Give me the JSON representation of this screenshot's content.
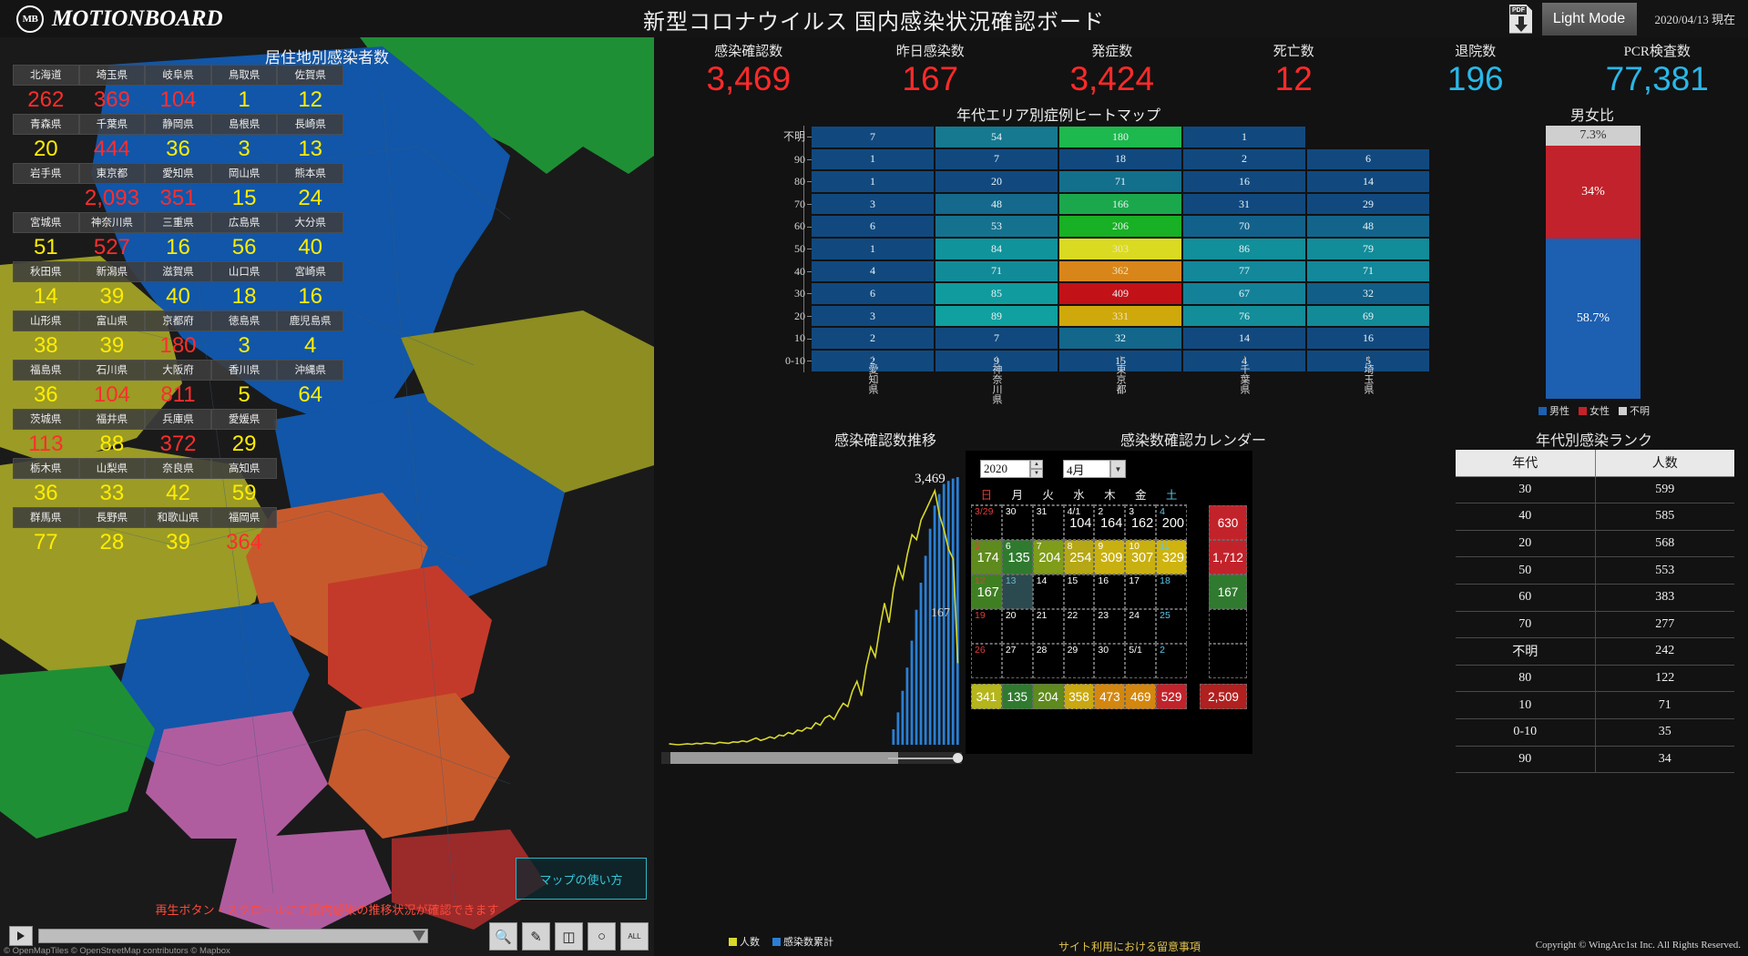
{
  "header": {
    "logo_text": "MOTIONBOARD",
    "logo_mark": "MB",
    "title": "新型コロナウイルス 国内感染状況確認ボード",
    "pdf_label": "PDF",
    "light_mode": "Light Mode",
    "date": "2020/04/13 現在"
  },
  "kpis": [
    {
      "label": "感染確認数",
      "value": "3,469",
      "color": "red"
    },
    {
      "label": "昨日感染数",
      "value": "167",
      "color": "red"
    },
    {
      "label": "発症数",
      "value": "3,424",
      "color": "red"
    },
    {
      "label": "死亡数",
      "value": "12",
      "color": "red"
    },
    {
      "label": "退院数",
      "value": "196",
      "color": "cyan"
    },
    {
      "label": "PCR検査数",
      "value": "77,381",
      "color": "cyan"
    }
  ],
  "map": {
    "title": "居住地別感染者数",
    "hint": "再生ボタン・スクロールにて国内感染の推移状況が確認できます",
    "howto": "マップの使い方",
    "attribution": "© OpenMapTiles © OpenStreetMap contributors © Mapbox",
    "prefectures": [
      {
        "name": "北海道",
        "value": "262",
        "color": "red"
      },
      {
        "name": "埼玉県",
        "value": "369",
        "color": "red"
      },
      {
        "name": "岐阜県",
        "value": "104",
        "color": "red"
      },
      {
        "name": "鳥取県",
        "value": "1",
        "color": "yellow"
      },
      {
        "name": "佐賀県",
        "value": "12",
        "color": "yellow"
      },
      {
        "name": "青森県",
        "value": "20",
        "color": "yellow"
      },
      {
        "name": "千葉県",
        "value": "444",
        "color": "red"
      },
      {
        "name": "静岡県",
        "value": "36",
        "color": "yellow"
      },
      {
        "name": "島根県",
        "value": "3",
        "color": "yellow"
      },
      {
        "name": "長崎県",
        "value": "13",
        "color": "yellow"
      },
      {
        "name": "岩手県",
        "value": "",
        "color": "yellow"
      },
      {
        "name": "東京都",
        "value": "2,093",
        "color": "red"
      },
      {
        "name": "愛知県",
        "value": "351",
        "color": "red"
      },
      {
        "name": "岡山県",
        "value": "15",
        "color": "yellow"
      },
      {
        "name": "熊本県",
        "value": "24",
        "color": "yellow"
      },
      {
        "name": "宮城県",
        "value": "51",
        "color": "yellow"
      },
      {
        "name": "神奈川県",
        "value": "527",
        "color": "red"
      },
      {
        "name": "三重県",
        "value": "16",
        "color": "yellow"
      },
      {
        "name": "広島県",
        "value": "56",
        "color": "yellow"
      },
      {
        "name": "大分県",
        "value": "40",
        "color": "yellow"
      },
      {
        "name": "秋田県",
        "value": "14",
        "color": "yellow"
      },
      {
        "name": "新潟県",
        "value": "39",
        "color": "yellow"
      },
      {
        "name": "滋賀県",
        "value": "40",
        "color": "yellow"
      },
      {
        "name": "山口県",
        "value": "18",
        "color": "yellow"
      },
      {
        "name": "宮崎県",
        "value": "16",
        "color": "yellow"
      },
      {
        "name": "山形県",
        "value": "38",
        "color": "yellow"
      },
      {
        "name": "富山県",
        "value": "39",
        "color": "yellow"
      },
      {
        "name": "京都府",
        "value": "180",
        "color": "red"
      },
      {
        "name": "徳島県",
        "value": "3",
        "color": "yellow"
      },
      {
        "name": "鹿児島県",
        "value": "4",
        "color": "yellow"
      },
      {
        "name": "福島県",
        "value": "36",
        "color": "yellow"
      },
      {
        "name": "石川県",
        "value": "104",
        "color": "red"
      },
      {
        "name": "大阪府",
        "value": "811",
        "color": "red"
      },
      {
        "name": "香川県",
        "value": "5",
        "color": "yellow"
      },
      {
        "name": "沖縄県",
        "value": "64",
        "color": "yellow"
      },
      {
        "name": "茨城県",
        "value": "113",
        "color": "red"
      },
      {
        "name": "福井県",
        "value": "88",
        "color": "yellow"
      },
      {
        "name": "兵庫県",
        "value": "372",
        "color": "red"
      },
      {
        "name": "愛媛県",
        "value": "29",
        "color": "yellow"
      },
      {
        "name": "",
        "value": "",
        "color": "yellow"
      },
      {
        "name": "栃木県",
        "value": "36",
        "color": "yellow"
      },
      {
        "name": "山梨県",
        "value": "33",
        "color": "yellow"
      },
      {
        "name": "奈良県",
        "value": "42",
        "color": "yellow"
      },
      {
        "name": "高知県",
        "value": "59",
        "color": "yellow"
      },
      {
        "name": "",
        "value": "",
        "color": "yellow"
      },
      {
        "name": "群馬県",
        "value": "77",
        "color": "yellow"
      },
      {
        "name": "長野県",
        "value": "28",
        "color": "yellow"
      },
      {
        "name": "和歌山県",
        "value": "39",
        "color": "yellow"
      },
      {
        "name": "福岡県",
        "value": "364",
        "color": "red"
      },
      {
        "name": "",
        "value": "",
        "color": "yellow"
      }
    ],
    "toolbar": [
      "search-icon",
      "pan-icon",
      "rect-icon",
      "lasso-icon",
      "all-icon"
    ],
    "all_label": "ALL"
  },
  "heatmap": {
    "title": "年代エリア別症例ヒートマップ",
    "row_labels": [
      "不明",
      "90",
      "80",
      "70",
      "60",
      "50",
      "40",
      "30",
      "20",
      "10",
      "0-10"
    ],
    "col_labels": [
      "愛知県",
      "神奈川県",
      "東京都",
      "千葉県",
      "埼玉県"
    ],
    "rows": [
      {
        "label": "不明",
        "values": [
          7,
          54,
          180,
          1,
          null
        ],
        "colors": [
          "#11497f",
          "#16798f",
          "#1db84e",
          "#11497f",
          "#000000"
        ]
      },
      {
        "label": "90",
        "values": [
          1,
          7,
          18,
          2,
          6
        ],
        "colors": [
          "#11497f",
          "#11497f",
          "#11497f",
          "#11497f",
          "#11497f"
        ]
      },
      {
        "label": "80",
        "values": [
          1,
          20,
          71,
          16,
          14
        ],
        "colors": [
          "#11497f",
          "#11497f",
          "#13708c",
          "#11497f",
          "#11497f"
        ]
      },
      {
        "label": "70",
        "values": [
          3,
          48,
          166,
          31,
          29
        ],
        "colors": [
          "#11497f",
          "#14698c",
          "#1ba84c",
          "#11497f",
          "#11497f"
        ]
      },
      {
        "label": "60",
        "values": [
          6,
          53,
          206,
          70,
          48
        ],
        "colors": [
          "#11497f",
          "#15728f",
          "#18b024",
          "#12618a",
          "#13648b"
        ]
      },
      {
        "label": "50",
        "values": [
          1,
          84,
          303,
          86,
          79
        ],
        "colors": [
          "#11497f",
          "#10939b",
          "#dada22",
          "#118f9a",
          "#128c99"
        ]
      },
      {
        "label": "40",
        "values": [
          4,
          71,
          362,
          77,
          71
        ],
        "colors": [
          "#11497f",
          "#128b98",
          "#d8861a",
          "#12889a",
          "#12889a"
        ]
      },
      {
        "label": "30",
        "values": [
          6,
          85,
          409,
          67,
          32
        ],
        "colors": [
          "#11497f",
          "#109c9e",
          "#c31118",
          "#138299",
          "#115e88"
        ]
      },
      {
        "label": "20",
        "values": [
          3,
          89,
          331,
          76,
          69
        ],
        "colors": [
          "#11497f",
          "#0fa09f",
          "#cfa80b",
          "#128d99",
          "#128a98"
        ]
      },
      {
        "label": "10",
        "values": [
          2,
          7,
          32,
          14,
          16
        ],
        "colors": [
          "#11497f",
          "#11497f",
          "#13678b",
          "#11497f",
          "#11497f"
        ]
      },
      {
        "label": "0-10",
        "values": [
          2,
          9,
          15,
          4,
          5
        ],
        "colors": [
          "#11497f",
          "#11497f",
          "#11497f",
          "#11497f",
          "#11497f"
        ]
      }
    ]
  },
  "gender": {
    "title": "男女比",
    "segments": [
      {
        "label": "7.3%",
        "pct": 7.3,
        "color": "#cfcfcf",
        "name": "不明"
      },
      {
        "label": "34%",
        "pct": 34.0,
        "color": "#c2222b",
        "name": "女性"
      },
      {
        "label": "58.7%",
        "pct": 58.7,
        "color": "#1d5fb0",
        "name": "男性"
      }
    ],
    "legend": [
      {
        "label": "男性",
        "color": "#1d5fb0"
      },
      {
        "label": "女性",
        "color": "#c2222b"
      },
      {
        "label": "不明",
        "color": "#cfcfcf"
      }
    ]
  },
  "trend": {
    "title": "感染確認数推移",
    "peak_label": "3,469",
    "secondary_label": "167",
    "legend": [
      {
        "label": "人数",
        "color": "#d8d82a"
      },
      {
        "label": "感染数累計",
        "color": "#2a7fd4"
      }
    ]
  },
  "chart_data": {
    "type": "line",
    "title": "感染確認数推移",
    "xlabel": "",
    "ylabel": "",
    "series": [
      {
        "name": "人数",
        "color": "#d8d82a",
        "values": [
          2,
          1,
          0,
          1,
          2,
          1,
          3,
          2,
          4,
          3,
          2,
          5,
          4,
          3,
          6,
          5,
          8,
          6,
          10,
          14,
          9,
          12,
          16,
          13,
          20,
          18,
          25,
          22,
          30,
          28,
          35,
          33,
          45,
          40,
          55,
          60,
          52,
          70,
          85,
          78,
          110,
          130,
          100,
          160,
          200,
          180,
          240,
          290,
          250,
          320,
          365,
          340,
          390,
          430,
          420,
          460,
          480,
          500,
          520,
          470,
          440,
          400,
          380,
          167
        ]
      },
      {
        "name": "感染数累計",
        "color": "#2a7fd4",
        "values": [
          0,
          0,
          0,
          0,
          0,
          0,
          0,
          0,
          0,
          0,
          0,
          0,
          0,
          0,
          0,
          0,
          0,
          0,
          0,
          0,
          0,
          0,
          0,
          0,
          0,
          0,
          0,
          0,
          0,
          0,
          0,
          0,
          0,
          0,
          0,
          0,
          0,
          0,
          0,
          0,
          0,
          0,
          0,
          0,
          0,
          0,
          0,
          0,
          0,
          200,
          420,
          700,
          1000,
          1350,
          1750,
          2100,
          2450,
          2800,
          3100,
          3250,
          3380,
          3420,
          3450,
          3469
        ]
      }
    ],
    "annotations": [
      {
        "text": "3,469",
        "note": "peak"
      },
      {
        "text": "167",
        "note": "last"
      }
    ]
  },
  "calendar": {
    "title": "感染数確認カレンダー",
    "year": "2020",
    "month": "4月",
    "dow": [
      "日",
      "月",
      "火",
      "水",
      "木",
      "金",
      "土"
    ],
    "weeks": [
      {
        "days": [
          {
            "d": "3/29",
            "n": "",
            "bg": "#000000",
            "dcolor": "#e03b3b"
          },
          {
            "d": "30",
            "n": "",
            "bg": "#000000",
            "dcolor": "#ffffff"
          },
          {
            "d": "31",
            "n": "",
            "bg": "#000000",
            "dcolor": "#ffffff"
          },
          {
            "d": "4/1",
            "n": "104",
            "bg": "#000000",
            "dcolor": "#ffffff"
          },
          {
            "d": "2",
            "n": "164",
            "bg": "#000000",
            "dcolor": "#ffffff"
          },
          {
            "d": "3",
            "n": "162",
            "bg": "#000000",
            "dcolor": "#ffffff"
          },
          {
            "d": "4",
            "n": "200",
            "bg": "#000000",
            "dcolor": "#5bc8e8"
          }
        ],
        "total": "630",
        "total_bg": "#c2232b"
      },
      {
        "days": [
          {
            "d": "5",
            "n": "174",
            "bg": "#5f8a1e",
            "dcolor": "#e03b3b"
          },
          {
            "d": "6",
            "n": "135",
            "bg": "#2f7a2f",
            "dcolor": "#ffffff"
          },
          {
            "d": "7",
            "n": "204",
            "bg": "#7f9c1a",
            "dcolor": "#ffffff"
          },
          {
            "d": "8",
            "n": "254",
            "bg": "#b5a715",
            "dcolor": "#ffffff"
          },
          {
            "d": "9",
            "n": "309",
            "bg": "#c9b011",
            "dcolor": "#ffffff"
          },
          {
            "d": "10",
            "n": "307",
            "bg": "#c9b011",
            "dcolor": "#ffffff"
          },
          {
            "d": "11",
            "n": "329",
            "bg": "#cfb40f",
            "dcolor": "#5bc8e8"
          }
        ],
        "total": "1,712",
        "total_bg": "#c2232b"
      },
      {
        "days": [
          {
            "d": "12",
            "n": "167",
            "bg": "#3f7f22",
            "dcolor": "#e03b3b"
          },
          {
            "d": "13",
            "n": "",
            "bg": "#2b4a4f",
            "dcolor": "#6bb7c4"
          },
          {
            "d": "14",
            "n": "",
            "bg": "#000000",
            "dcolor": "#ffffff"
          },
          {
            "d": "15",
            "n": "",
            "bg": "#000000",
            "dcolor": "#ffffff"
          },
          {
            "d": "16",
            "n": "",
            "bg": "#000000",
            "dcolor": "#ffffff"
          },
          {
            "d": "17",
            "n": "",
            "bg": "#000000",
            "dcolor": "#ffffff"
          },
          {
            "d": "18",
            "n": "",
            "bg": "#000000",
            "dcolor": "#5bc8e8"
          }
        ],
        "total": "167",
        "total_bg": "#2f7a2f"
      },
      {
        "days": [
          {
            "d": "19",
            "n": "",
            "bg": "#000000",
            "dcolor": "#e03b3b"
          },
          {
            "d": "20",
            "n": "",
            "bg": "#000000",
            "dcolor": "#ffffff"
          },
          {
            "d": "21",
            "n": "",
            "bg": "#000000",
            "dcolor": "#ffffff"
          },
          {
            "d": "22",
            "n": "",
            "bg": "#000000",
            "dcolor": "#ffffff"
          },
          {
            "d": "23",
            "n": "",
            "bg": "#000000",
            "dcolor": "#ffffff"
          },
          {
            "d": "24",
            "n": "",
            "bg": "#000000",
            "dcolor": "#ffffff"
          },
          {
            "d": "25",
            "n": "",
            "bg": "#000000",
            "dcolor": "#5bc8e8"
          }
        ],
        "total": "",
        "total_bg": "#000000"
      },
      {
        "days": [
          {
            "d": "26",
            "n": "",
            "bg": "#000000",
            "dcolor": "#e03b3b"
          },
          {
            "d": "27",
            "n": "",
            "bg": "#000000",
            "dcolor": "#ffffff"
          },
          {
            "d": "28",
            "n": "",
            "bg": "#000000",
            "dcolor": "#ffffff"
          },
          {
            "d": "29",
            "n": "",
            "bg": "#000000",
            "dcolor": "#ffffff"
          },
          {
            "d": "30",
            "n": "",
            "bg": "#000000",
            "dcolor": "#ffffff"
          },
          {
            "d": "5/1",
            "n": "",
            "bg": "#000000",
            "dcolor": "#ffffff"
          },
          {
            "d": "2",
            "n": "",
            "bg": "#000000",
            "dcolor": "#5bc8e8"
          }
        ],
        "total": "",
        "total_bg": "#000000"
      }
    ],
    "footer": [
      {
        "v": "341",
        "bg": "#b5b51c"
      },
      {
        "v": "135",
        "bg": "#2f7a2f"
      },
      {
        "v": "204",
        "bg": "#5f8a1e"
      },
      {
        "v": "358",
        "bg": "#c9a810"
      },
      {
        "v": "473",
        "bg": "#d4870f"
      },
      {
        "v": "469",
        "bg": "#d4870f"
      },
      {
        "v": "529",
        "bg": "#c2232b"
      }
    ],
    "footer_total": "2,509"
  },
  "rank": {
    "title": "年代別感染ランク",
    "columns": [
      "年代",
      "人数"
    ],
    "rows": [
      [
        "30",
        "599"
      ],
      [
        "40",
        "585"
      ],
      [
        "20",
        "568"
      ],
      [
        "50",
        "553"
      ],
      [
        "60",
        "383"
      ],
      [
        "70",
        "277"
      ],
      [
        "不明",
        "242"
      ],
      [
        "80",
        "122"
      ],
      [
        "10",
        "71"
      ],
      [
        "0-10",
        "35"
      ],
      [
        "90",
        "34"
      ]
    ]
  },
  "footer": {
    "link": "サイト利用における留意事項",
    "copyright": "Copyright © WingArc1st Inc. All Rights Reserved."
  }
}
